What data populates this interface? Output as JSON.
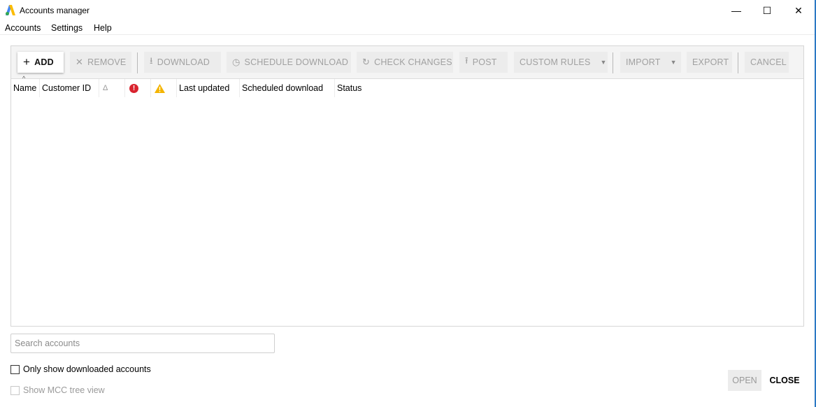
{
  "window": {
    "title": "Accounts manager",
    "controls": {
      "minimize": "—",
      "maximize": "☐",
      "close": "✕"
    }
  },
  "menu": [
    {
      "label": "Accounts"
    },
    {
      "label": "Settings"
    },
    {
      "label": "Help"
    }
  ],
  "toolbar": {
    "add": {
      "label": "ADD",
      "icon": "+"
    },
    "remove": {
      "label": "REMOVE",
      "icon": "✕"
    },
    "download": {
      "label": "DOWNLOAD",
      "icon": "⭳"
    },
    "schedule_download": {
      "label": "SCHEDULE DOWNLOAD",
      "icon": "◷"
    },
    "check_changes": {
      "label": "CHECK CHANGES",
      "icon": "↻"
    },
    "post": {
      "label": "POST",
      "icon": "⭱"
    },
    "custom_rules": {
      "label": "CUSTOM RULES",
      "caret": "▼"
    },
    "import": {
      "label": "IMPORT",
      "caret": "▼"
    },
    "export": {
      "label": "EXPORT"
    },
    "cancel": {
      "label": "CANCEL"
    }
  },
  "table": {
    "sort_indicator": "^",
    "columns": [
      {
        "label": "Name"
      },
      {
        "label": "Customer ID"
      },
      {
        "label": "",
        "icon": "delta-icon",
        "glyph": "Δ"
      },
      {
        "label": "",
        "icon": "error-icon",
        "glyph": "!"
      },
      {
        "label": "",
        "icon": "warning-icon",
        "glyph": "!"
      },
      {
        "label": "Last updated"
      },
      {
        "label": "Scheduled download"
      },
      {
        "label": "Status"
      }
    ],
    "rows": []
  },
  "search": {
    "placeholder": "Search accounts",
    "value": ""
  },
  "options": {
    "only_downloaded": {
      "label": "Only show downloaded accounts",
      "checked": false
    },
    "mcc_tree": {
      "label": "Show MCC tree view",
      "checked": false,
      "enabled": false
    }
  },
  "footer": {
    "open": "OPEN",
    "close": "CLOSE"
  },
  "colors": {
    "error": "#d9232e",
    "warning": "#f4b400",
    "logo_blue": "#4285f4",
    "logo_green": "#34a853",
    "logo_yellow": "#fbbc04"
  }
}
